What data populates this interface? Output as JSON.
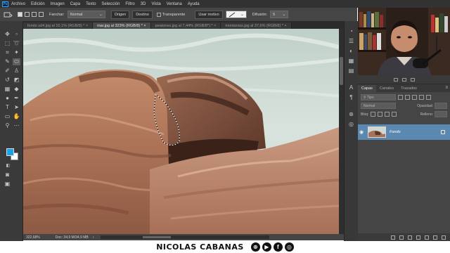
{
  "app": {
    "logo_text": "Ps"
  },
  "menubar": {
    "items": [
      "Archivo",
      "Edición",
      "Imagen",
      "Capa",
      "Texto",
      "Selección",
      "Filtro",
      "3D",
      "Vista",
      "Ventana",
      "Ayuda"
    ]
  },
  "options": {
    "feather_label": "Fanchar:",
    "mode_value": "Normal",
    "source_label": "Origen",
    "dest_label": "Destino",
    "transparent_label": "Transparente",
    "use_pattern_label": "Usar motivo",
    "diffusion_label": "Difusión:",
    "diffusion_value": "5"
  },
  "tabs": [
    {
      "label": "fondo sd4.jpg al 10,1% (RGB/8) *",
      "active": false
    },
    {
      "label": "mar.jpg al 323% (RGB/8) *",
      "active": true
    },
    {
      "label": "peatones.jpg al 7,44% (RGB/8*) *",
      "active": false
    },
    {
      "label": "montanias.jpg al 37,6% (RGB/8) *",
      "active": false
    }
  ],
  "status": {
    "zoom": "322,68%",
    "doc": "Doc: 34,9 M/34,9 MB"
  },
  "layers_panel": {
    "tabs": [
      "Capas",
      "Canales",
      "Trazados"
    ],
    "filter_placeholder": "Tipo",
    "blend_mode": "Normal",
    "opacity_label": "Opacidad:",
    "lock_label": "Bloq:",
    "fill_label": "Relleno:",
    "layer_name": "Fondo"
  },
  "footer": {
    "author": "NICOLAS CABANAS",
    "icons": [
      "globe-icon",
      "youtube-icon",
      "facebook-icon",
      "instagram-icon"
    ]
  },
  "colors": {
    "foreground": "#1aa1e6",
    "background": "#ffffff",
    "selected_layer": "#5a88b0",
    "ui_dark": "#323232",
    "ui_panel": "#454545"
  }
}
